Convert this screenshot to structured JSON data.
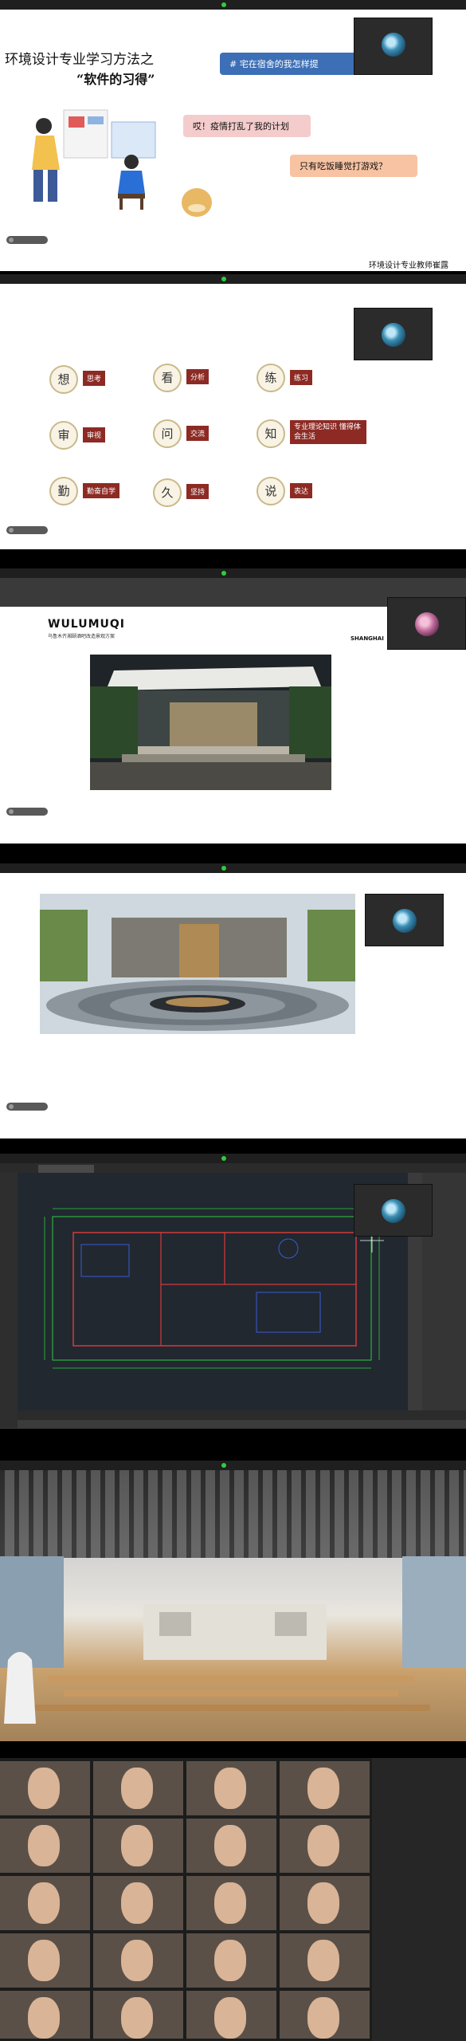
{
  "meeting": {
    "recording_label": "",
    "self_label": "",
    "thumb_title": "",
    "thumb_name": ""
  },
  "slide1": {
    "title": "环境设计专业学习方法之",
    "subtitle": "“软件的习得”",
    "bubble_1": "# 宅在宿舍的我怎样提",
    "bubble_2": "哎！疫情打乱了我的计划",
    "bubble_3": "只有吃饭睡觉打游戏？",
    "teacher": "环境设计专业教师崔露"
  },
  "slide2": {
    "items": [
      {
        "char": "想",
        "label": "思考"
      },
      {
        "char": "看",
        "label": "分析"
      },
      {
        "char": "练",
        "label": "练习"
      },
      {
        "char": "审",
        "label": "审视"
      },
      {
        "char": "问",
        "label": "交流"
      },
      {
        "char": "知",
        "label": "专业理论知识 懂得体会生活"
      },
      {
        "char": "勤",
        "label": "勤奋自学"
      },
      {
        "char": "久",
        "label": "坚持"
      },
      {
        "char": "说",
        "label": "表达"
      }
    ]
  },
  "slide3": {
    "heading": "WULUMUQI",
    "subheading": "乌鲁木齐湘颐酒吧改造景观方案",
    "side_text": "SHANGHAI"
  },
  "slide4": {
    "caption_left": "",
    "caption_right": ""
  },
  "slide5": {
    "cad_file": ""
  },
  "colors": {
    "accent_red": "#8d2a24",
    "bubble_blue": "#3d6fb6",
    "bubble_pink": "#f4cccc",
    "bubble_orange": "#f7c3a3",
    "cad_green": "#2ecc40",
    "cad_red": "#d33a3a"
  }
}
